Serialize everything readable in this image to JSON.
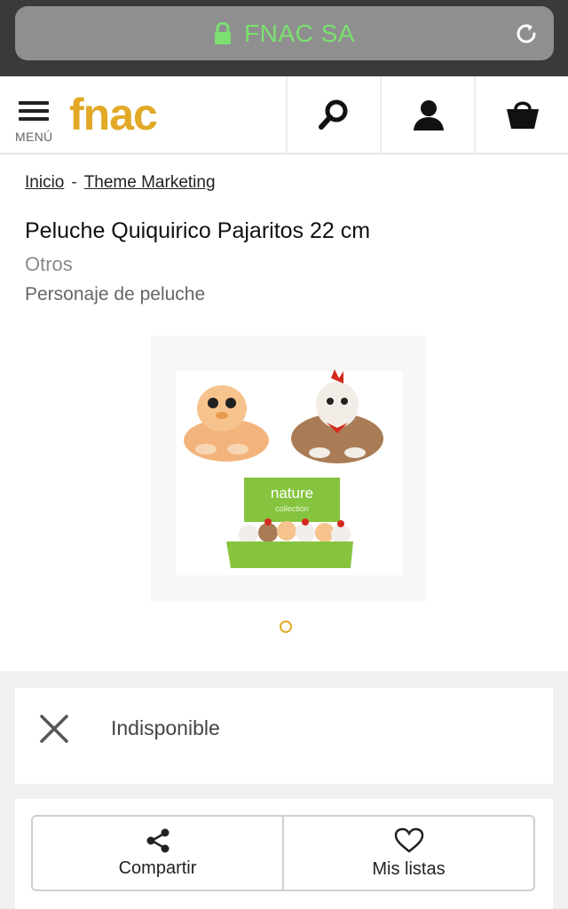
{
  "browser": {
    "url_title": "FNAC SA"
  },
  "header": {
    "menu_label": "MENÚ",
    "logo_text": "fnac"
  },
  "breadcrumb": {
    "items": [
      "Inicio",
      "Theme Marketing"
    ],
    "separator": "-"
  },
  "product": {
    "title": "Peluche Quiquirico Pajaritos 22 cm",
    "brand": "Otros",
    "type": "Personaje de peluche",
    "image_box_label": "nature",
    "image_box_sublabel": "collection"
  },
  "availability": {
    "status": "Indisponible"
  },
  "actions": {
    "share_label": "Compartir",
    "lists_label": "Mis listas"
  },
  "colors": {
    "brand": "#e1a925",
    "url_green": "#7be070"
  }
}
